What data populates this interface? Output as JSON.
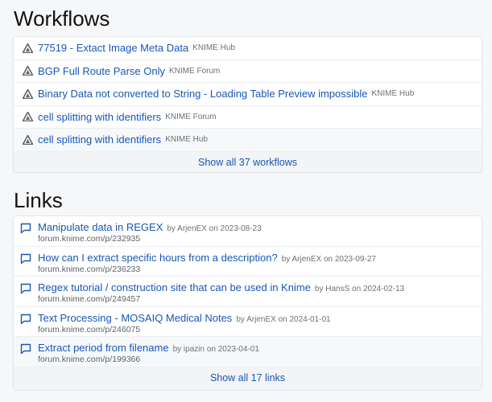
{
  "workflows": {
    "title": "Workflows",
    "items": [
      {
        "title": "77519 - Extact Image Meta Data",
        "source": "KNIME Hub"
      },
      {
        "title": "BGP Full Route Parse Only",
        "source": "KNIME Forum"
      },
      {
        "title": "Binary Data not converted to String - Loading Table Preview impossible",
        "source": "KNIME Hub"
      },
      {
        "title": "cell splitting with identifiers",
        "source": "KNIME Forum"
      },
      {
        "title": "cell splitting with identifiers",
        "source": "KNIME Hub"
      }
    ],
    "show_all": "Show all 37 workflows"
  },
  "links": {
    "title": "Links",
    "items": [
      {
        "title": "Manipulate data in REGEX",
        "meta": "by ArjenEX on 2023-08-23",
        "url": "forum.knime.com/p/232935"
      },
      {
        "title": "How can I extract specific hours from a description?",
        "meta": "by ArjenEX on 2023-09-27",
        "url": "forum.knime.com/p/236233"
      },
      {
        "title": "Regex tutorial / construction site that can be used in Knime",
        "meta": "by HansS on 2024-02-13",
        "url": "forum.knime.com/p/249457"
      },
      {
        "title": "Text Processing - MOSAIQ Medical Notes",
        "meta": "by ArjenEX on 2024-01-01",
        "url": "forum.knime.com/p/246075"
      },
      {
        "title": "Extract period from filename",
        "meta": "by ipazin on 2023-04-01",
        "url": "forum.knime.com/p/199366"
      }
    ],
    "show_all": "Show all 17 links"
  },
  "icons": {
    "workflow": "knime-workflow-icon",
    "link": "chat-bubble-icon"
  },
  "colors": {
    "link": "#1757b8",
    "muted": "#6b7178"
  }
}
